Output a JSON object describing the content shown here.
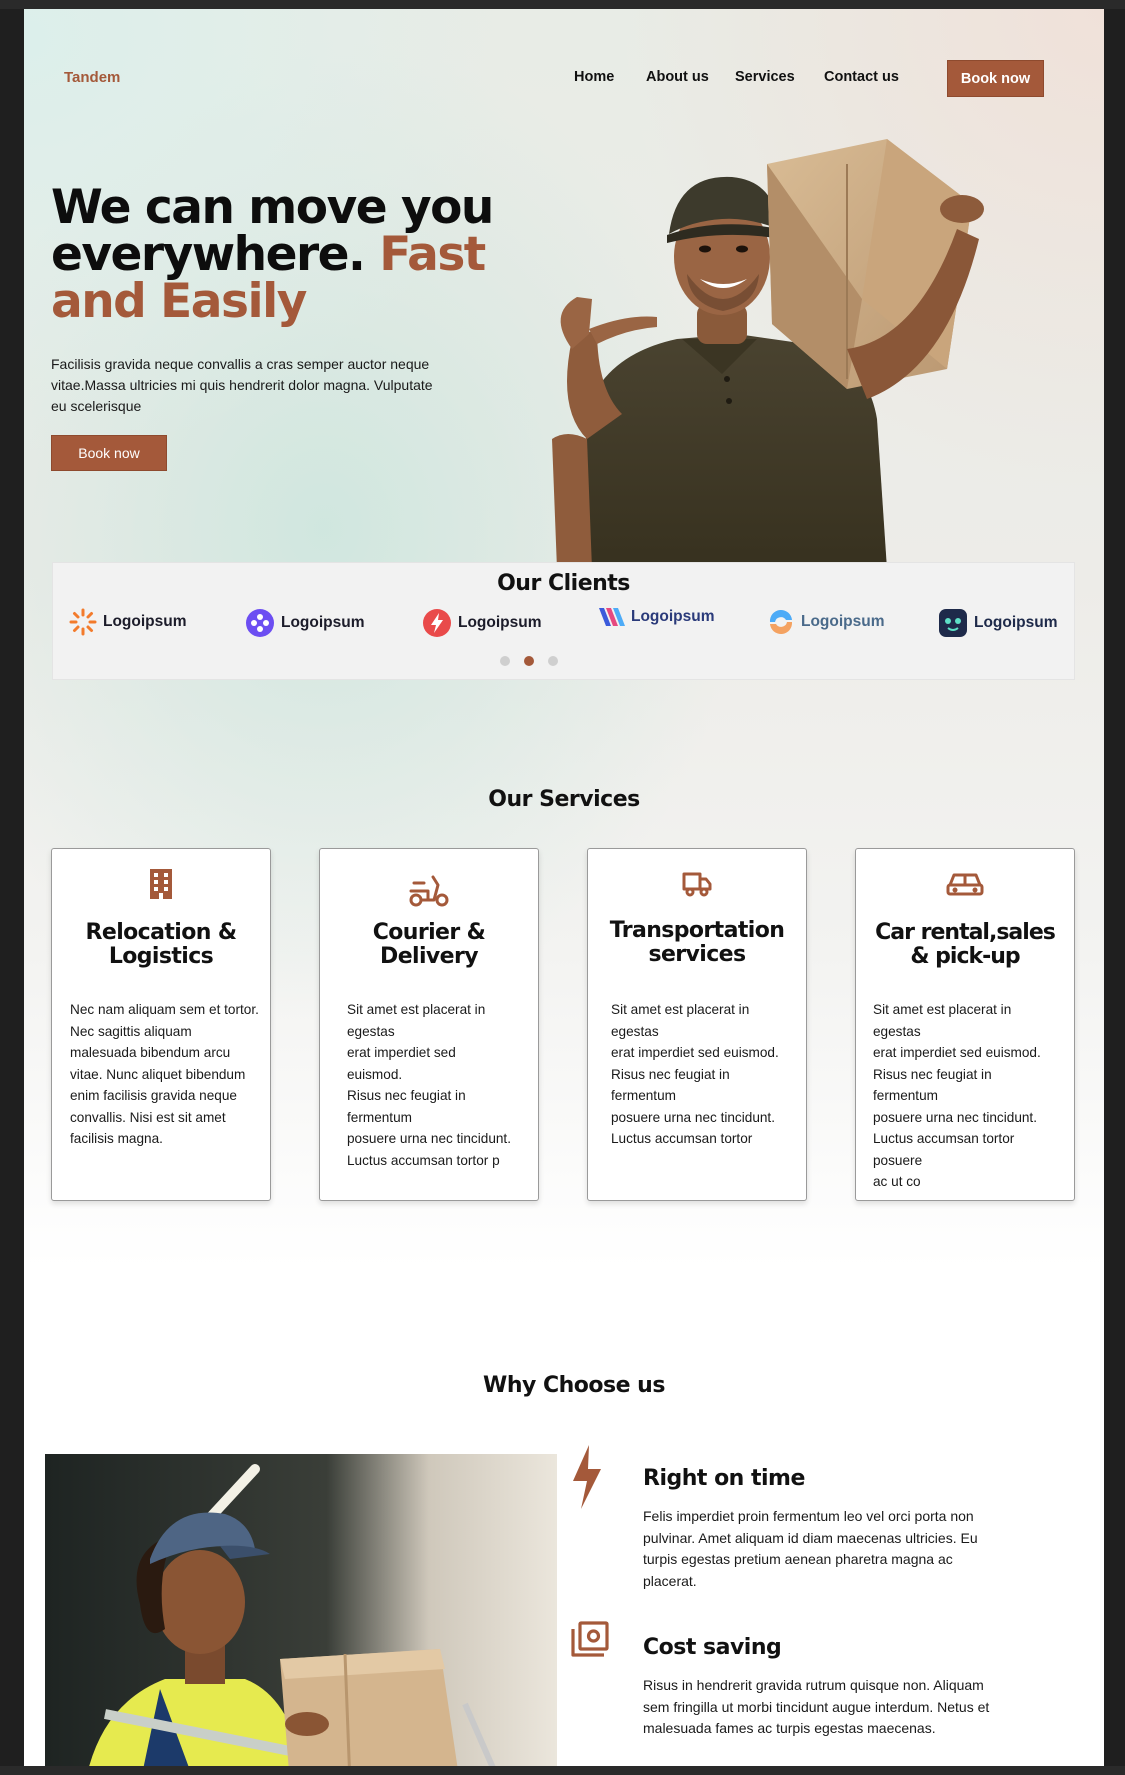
{
  "brand": "Tandem",
  "nav": {
    "items": [
      "Home",
      "About us",
      "Services",
      "Contact us"
    ],
    "cta": "Book now"
  },
  "hero": {
    "title_line1": "We can move you",
    "title_line2a": "everywhere.",
    "title_line2b": "Fast",
    "title_line3": "and Easily",
    "text": "Facilisis gravida neque convallis a cras semper auctor neque vitae.Massa ultricies mi quis hendrerit dolor magna. Vulputate eu scelerisque",
    "cta": "Book now"
  },
  "clients": {
    "title": "Our Clients",
    "logos": [
      "Logoipsum",
      "Logoipsum",
      "Logoipsum",
      "Logoipsum",
      "Logoipsum",
      "Logoipsum"
    ],
    "active_dot": 2,
    "dot_count": 3
  },
  "services": {
    "title": "Our Services",
    "cards": [
      {
        "icon": "building-icon",
        "title": "Relocation &\nLogistics",
        "text": "Nec nam aliquam sem et tortor. Nec sagittis aliquam  malesuada bibendum arcu vitae. Nunc aliquet bibendum enim facilisis gravida neque convallis. Nisi est sit amet facilisis magna."
      },
      {
        "icon": "scooter-icon",
        "title": "Courier &\nDelivery",
        "text": "Sit amet est placerat in\negestas\nerat imperdiet sed\neuismod.\nRisus nec feugiat in\nfermentum\nposuere urna nec tincidunt.\nLuctus accumsan tortor p"
      },
      {
        "icon": "truck-icon",
        "title": "Transportation\nservices",
        "text": "Sit amet est placerat in\negestas\nerat imperdiet sed euismod.\nRisus nec feugiat in\nfermentum\nposuere urna nec tincidunt.\nLuctus accumsan tortor"
      },
      {
        "icon": "car-icon",
        "title": "Car rental,sales\n& pick-up",
        "text": "Sit amet est placerat in\negestas\nerat imperdiet sed euismod.\nRisus nec feugiat in\nfermentum\nposuere urna nec tincidunt.\nLuctus accumsan tortor\nposuere\nac ut co"
      }
    ]
  },
  "why": {
    "title": "Why Choose us",
    "features": [
      {
        "icon": "lightning-icon",
        "title": "Right on time",
        "text": "Felis imperdiet proin fermentum leo vel orci porta non pulvinar. Amet aliquam id diam maecenas ultricies. Eu turpis egestas pretium aenean pharetra magna ac placerat."
      },
      {
        "icon": "money-icon",
        "title": "Cost saving",
        "text": "Risus in hendrerit gravida rutrum quisque non. Aliquam sem fringilla ut morbi tincidunt augue interdum. Netus et malesuada fames ac turpis egestas maecenas."
      }
    ]
  },
  "colors": {
    "accent": "#a4593a",
    "text": "#111111"
  }
}
